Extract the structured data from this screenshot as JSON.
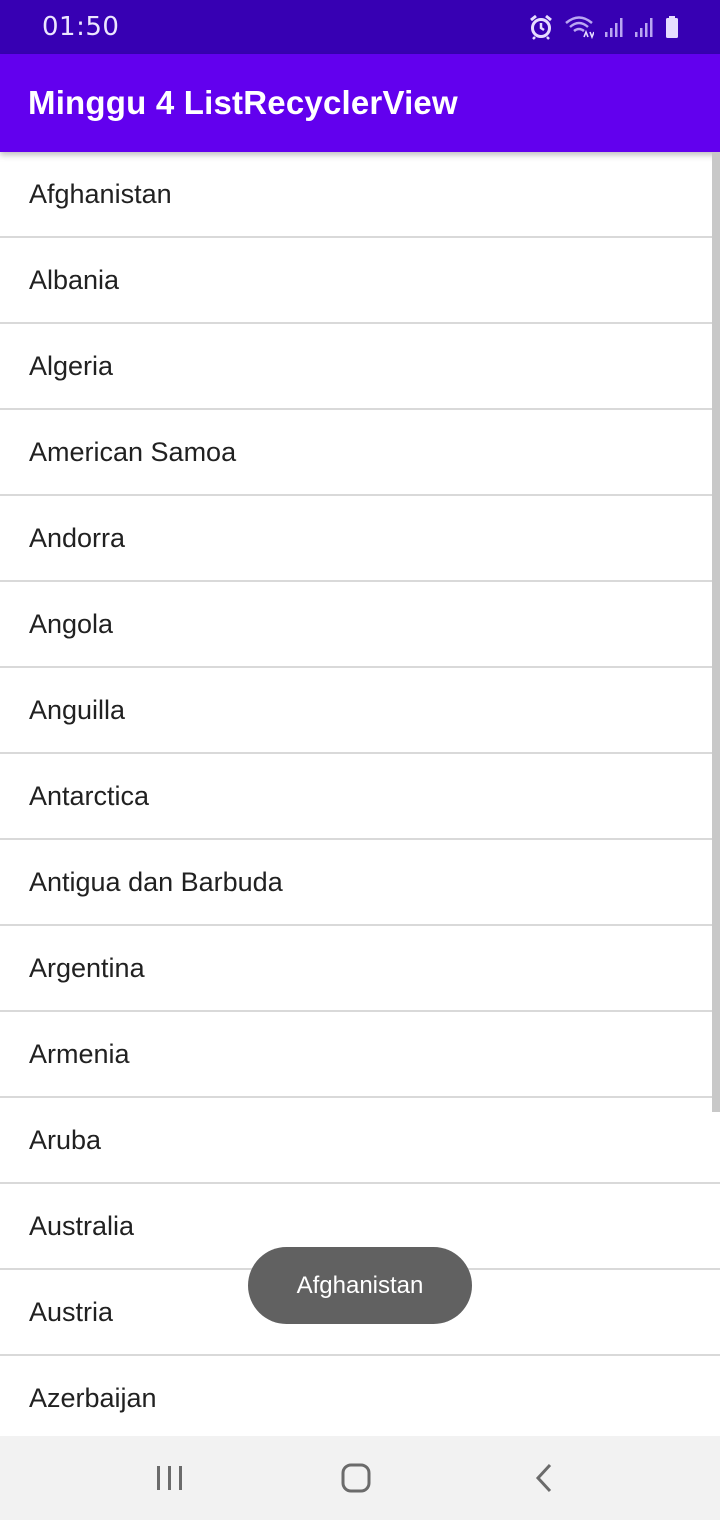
{
  "status_bar": {
    "time": "01:50",
    "icons": [
      "alarm-icon",
      "wifi-icon",
      "signal-icon",
      "signal-icon",
      "battery-icon"
    ]
  },
  "app_bar": {
    "title": "Minggu 4 ListRecyclerView"
  },
  "list": {
    "items": [
      {
        "label": "Afghanistan"
      },
      {
        "label": "Albania"
      },
      {
        "label": "Algeria"
      },
      {
        "label": "American Samoa"
      },
      {
        "label": "Andorra"
      },
      {
        "label": "Angola"
      },
      {
        "label": "Anguilla"
      },
      {
        "label": "Antarctica"
      },
      {
        "label": "Antigua dan Barbuda"
      },
      {
        "label": "Argentina"
      },
      {
        "label": "Armenia"
      },
      {
        "label": "Aruba"
      },
      {
        "label": "Australia"
      },
      {
        "label": "Austria"
      },
      {
        "label": "Azerbaijan"
      }
    ]
  },
  "toast": {
    "message": "Afghanistan"
  },
  "nav_bar": {
    "icons": [
      "recent-apps-icon",
      "home-icon",
      "back-icon"
    ]
  },
  "colors": {
    "status_bar": "#3700B3",
    "app_bar": "#6200EE",
    "toast": "#616161",
    "divider": "#D9D9D9"
  }
}
